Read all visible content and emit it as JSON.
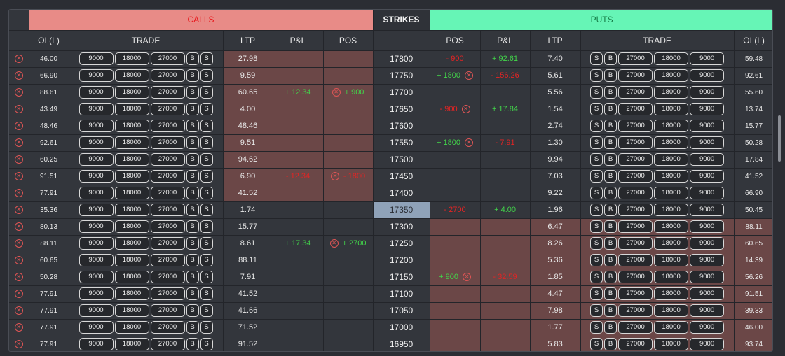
{
  "header": {
    "calls_label": "CALLS",
    "strikes_label": "STRIKES",
    "puts_label": "PUTS"
  },
  "columns": {
    "oi": "OI (L)",
    "trade": "TRADE",
    "ltp": "LTP",
    "pnl": "P&L",
    "pos": "POS"
  },
  "trade_buttons": {
    "q1": "9000",
    "q2": "18000",
    "q3": "27000",
    "buy": "B",
    "sell": "S"
  },
  "close_icon": "close-circle-icon",
  "colors": {
    "calls_header": "#e88b87",
    "puts_header": "#66f5b6",
    "itm_cell": "#6b4747",
    "atm_strike": "#8fa2b8",
    "profit": "#42d44a",
    "loss": "#e32424"
  },
  "rows": [
    {
      "call_oi": "46.00",
      "call_ltp": "27.98",
      "call_pnl": "",
      "call_pnl_sign": "",
      "call_pos": "",
      "call_pos_sign": "",
      "strike": "17800",
      "put_pos": "- 900",
      "put_pos_sign": "neg",
      "put_pos_x": false,
      "put_pnl": "+ 92.61",
      "put_pnl_sign": "pos",
      "put_ltp": "7.40",
      "put_oi": "59.48"
    },
    {
      "call_oi": "66.90",
      "call_ltp": "9.59",
      "call_pnl": "",
      "call_pnl_sign": "",
      "call_pos": "",
      "call_pos_sign": "",
      "strike": "17750",
      "put_pos": "+ 1800",
      "put_pos_sign": "pos",
      "put_pos_x": true,
      "put_pnl": "- 156.26",
      "put_pnl_sign": "neg",
      "put_ltp": "5.61",
      "put_oi": "92.61"
    },
    {
      "call_oi": "88.61",
      "call_ltp": "60.65",
      "call_pnl": "+ 12.34",
      "call_pnl_sign": "pos",
      "call_pos": "+ 900",
      "call_pos_sign": "pos",
      "strike": "17700",
      "put_pos": "",
      "put_pos_sign": "",
      "put_pos_x": false,
      "put_pnl": "",
      "put_pnl_sign": "",
      "put_ltp": "5.56",
      "put_oi": "55.60"
    },
    {
      "call_oi": "43.49",
      "call_ltp": "4.00",
      "call_pnl": "",
      "call_pnl_sign": "",
      "call_pos": "",
      "call_pos_sign": "",
      "strike": "17650",
      "put_pos": "- 900",
      "put_pos_sign": "neg",
      "put_pos_x": true,
      "put_pnl": "+ 17.84",
      "put_pnl_sign": "pos",
      "put_ltp": "1.54",
      "put_oi": "13.74"
    },
    {
      "call_oi": "48.46",
      "call_ltp": "48.46",
      "call_pnl": "",
      "call_pnl_sign": "",
      "call_pos": "",
      "call_pos_sign": "",
      "strike": "17600",
      "put_pos": "",
      "put_pos_sign": "",
      "put_pos_x": false,
      "put_pnl": "",
      "put_pnl_sign": "",
      "put_ltp": "2.74",
      "put_oi": "15.77"
    },
    {
      "call_oi": "92.61",
      "call_ltp": "9.51",
      "call_pnl": "",
      "call_pnl_sign": "",
      "call_pos": "",
      "call_pos_sign": "",
      "strike": "17550",
      "put_pos": "+ 1800",
      "put_pos_sign": "pos",
      "put_pos_x": true,
      "put_pnl": "- 7.91",
      "put_pnl_sign": "neg",
      "put_ltp": "1.30",
      "put_oi": "50.28"
    },
    {
      "call_oi": "60.25",
      "call_ltp": "94.62",
      "call_pnl": "",
      "call_pnl_sign": "",
      "call_pos": "",
      "call_pos_sign": "",
      "strike": "17500",
      "put_pos": "",
      "put_pos_sign": "",
      "put_pos_x": false,
      "put_pnl": "",
      "put_pnl_sign": "",
      "put_ltp": "9.94",
      "put_oi": "17.84"
    },
    {
      "call_oi": "91.51",
      "call_ltp": "6.90",
      "call_pnl": "- 12.34",
      "call_pnl_sign": "neg",
      "call_pos": "- 1800",
      "call_pos_sign": "neg",
      "strike": "17450",
      "put_pos": "",
      "put_pos_sign": "",
      "put_pos_x": false,
      "put_pnl": "",
      "put_pnl_sign": "",
      "put_ltp": "7.03",
      "put_oi": "41.52"
    },
    {
      "call_oi": "77.91",
      "call_ltp": "41.52",
      "call_pnl": "",
      "call_pnl_sign": "",
      "call_pos": "",
      "call_pos_sign": "",
      "strike": "17400",
      "put_pos": "",
      "put_pos_sign": "",
      "put_pos_x": false,
      "put_pnl": "",
      "put_pnl_sign": "",
      "put_ltp": "9.22",
      "put_oi": "66.90"
    },
    {
      "call_oi": "35.36",
      "call_ltp": "1.74",
      "call_pnl": "",
      "call_pnl_sign": "",
      "call_pos": "",
      "call_pos_sign": "",
      "strike": "17350",
      "put_pos": "- 2700",
      "put_pos_sign": "neg",
      "put_pos_x": false,
      "put_pnl": "+ 4.00",
      "put_pnl_sign": "pos",
      "put_ltp": "1.96",
      "put_oi": "50.45"
    },
    {
      "call_oi": "80.13",
      "call_ltp": "15.77",
      "call_pnl": "",
      "call_pnl_sign": "",
      "call_pos": "",
      "call_pos_sign": "",
      "strike": "17300",
      "put_pos": "",
      "put_pos_sign": "",
      "put_pos_x": false,
      "put_pnl": "",
      "put_pnl_sign": "",
      "put_ltp": "6.47",
      "put_oi": "88.11"
    },
    {
      "call_oi": "88.11",
      "call_ltp": "8.61",
      "call_pnl": "+ 17.34",
      "call_pnl_sign": "pos",
      "call_pos": "+ 2700",
      "call_pos_sign": "pos",
      "strike": "17250",
      "put_pos": "",
      "put_pos_sign": "",
      "put_pos_x": false,
      "put_pnl": "",
      "put_pnl_sign": "",
      "put_ltp": "8.26",
      "put_oi": "60.65"
    },
    {
      "call_oi": "60.65",
      "call_ltp": "88.11",
      "call_pnl": "",
      "call_pnl_sign": "",
      "call_pos": "",
      "call_pos_sign": "",
      "strike": "17200",
      "put_pos": "",
      "put_pos_sign": "",
      "put_pos_x": false,
      "put_pnl": "",
      "put_pnl_sign": "",
      "put_ltp": "5.36",
      "put_oi": "14.39"
    },
    {
      "call_oi": "50.28",
      "call_ltp": "7.91",
      "call_pnl": "",
      "call_pnl_sign": "",
      "call_pos": "",
      "call_pos_sign": "",
      "strike": "17150",
      "put_pos": "+ 900",
      "put_pos_sign": "pos",
      "put_pos_x": true,
      "put_pnl": "- 32.59",
      "put_pnl_sign": "neg",
      "put_ltp": "1.85",
      "put_oi": "56.26"
    },
    {
      "call_oi": "77.91",
      "call_ltp": "41.52",
      "call_pnl": "",
      "call_pnl_sign": "",
      "call_pos": "",
      "call_pos_sign": "",
      "strike": "17100",
      "put_pos": "",
      "put_pos_sign": "",
      "put_pos_x": false,
      "put_pnl": "",
      "put_pnl_sign": "",
      "put_ltp": "4.47",
      "put_oi": "91.51"
    },
    {
      "call_oi": "77.91",
      "call_ltp": "41.66",
      "call_pnl": "",
      "call_pnl_sign": "",
      "call_pos": "",
      "call_pos_sign": "",
      "strike": "17050",
      "put_pos": "",
      "put_pos_sign": "",
      "put_pos_x": false,
      "put_pnl": "",
      "put_pnl_sign": "",
      "put_ltp": "7.98",
      "put_oi": "39.33"
    },
    {
      "call_oi": "77.91",
      "call_ltp": "71.52",
      "call_pnl": "",
      "call_pnl_sign": "",
      "call_pos": "",
      "call_pos_sign": "",
      "strike": "17000",
      "put_pos": "",
      "put_pos_sign": "",
      "put_pos_x": false,
      "put_pnl": "",
      "put_pnl_sign": "",
      "put_ltp": "1.77",
      "put_oi": "46.00"
    },
    {
      "call_oi": "77.91",
      "call_ltp": "91.52",
      "call_pnl": "",
      "call_pnl_sign": "",
      "call_pos": "",
      "call_pos_sign": "",
      "strike": "16950",
      "put_pos": "",
      "put_pos_sign": "",
      "put_pos_x": false,
      "put_pnl": "",
      "put_pnl_sign": "",
      "put_ltp": "5.83",
      "put_oi": "93.74"
    }
  ]
}
